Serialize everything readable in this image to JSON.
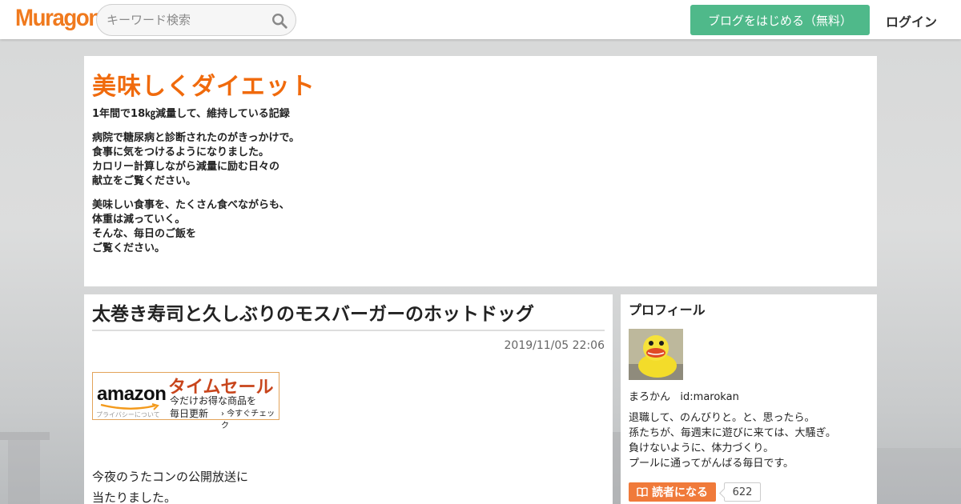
{
  "header": {
    "logo": "Muragon",
    "search_placeholder": "キーワード検索",
    "signup_label": "ブログをはじめる（無料）",
    "login_label": "ログイン"
  },
  "blog": {
    "title": "美味しくダイエット",
    "subtitle": "1年間で18㎏減量して、維持している記録",
    "description": [
      "病院で糖尿病と診断されたのがきっかけで。\n食事に気をつけるようになりました。\nカロリー計算しながら減量に励む日々の\n献立をご覧ください。",
      "美味しい食事を、たくさん食べながらも、\n体重は減っていく。\nそんな、毎日のご飯を\nご覧ください。"
    ]
  },
  "article": {
    "title": "太巻き寿司と久しぶりのモスバーガーのホットドッグ",
    "date": "2019/11/05 22:06",
    "amazon_banner": {
      "logo": "amazon",
      "privacy": "プライバシーについて",
      "headline": "タイムセール",
      "line1": "今だけお得な商品を",
      "line2": "毎日更新",
      "cta": "› 今すぐチェック"
    },
    "body_lines": [
      "今夜のうたコンの公開放送に",
      "当たりました。"
    ]
  },
  "sidebar": {
    "heading": "プロフィール",
    "name": "まろかん",
    "user_id": "id:marokan",
    "bio": "退職して、のんびりと。と、思ったら。\n孫たちが、毎週末に遊びに来ては、大騒ぎ。\n負けないように、体力づくり。\nプールに通ってがんばる毎日です。",
    "follow_label": "読者になる",
    "follower_count": "622"
  },
  "colors": {
    "brand_orange": "#f07a1e",
    "title_orange": "#f06a0c",
    "signup_green": "#4fb98a",
    "follow_orange": "#f07a3a",
    "amazon_sale_red": "#c8451c"
  }
}
